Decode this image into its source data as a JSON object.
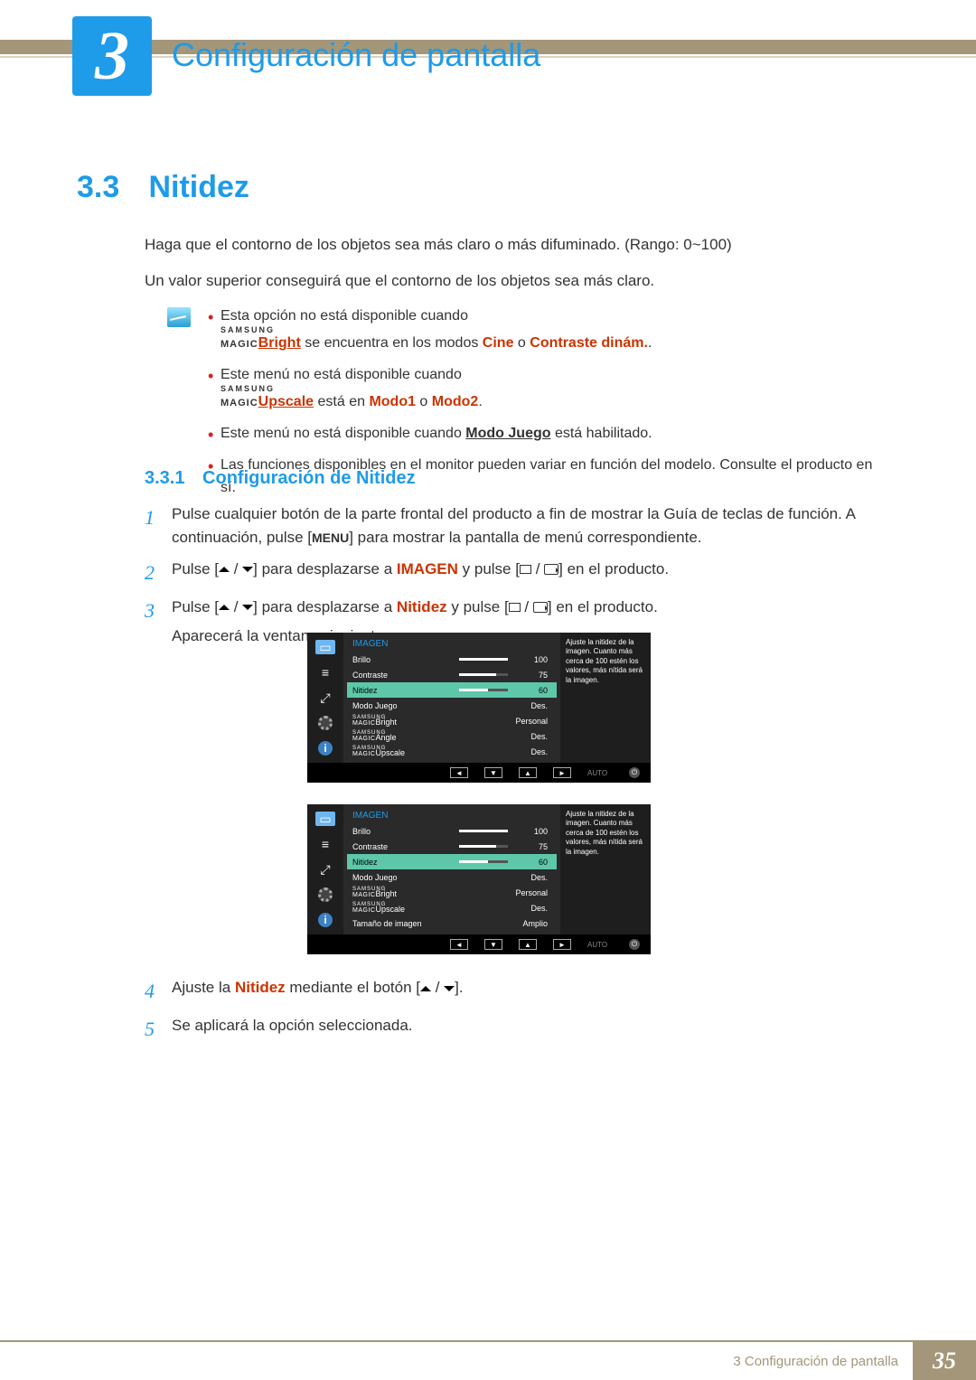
{
  "chapter": {
    "number": "3",
    "title": "Configuración de pantalla"
  },
  "section": {
    "number": "3.3",
    "title": "Nitidez"
  },
  "para1": "Haga que el contorno de los objetos sea más claro o más difuminado. (Rango: 0~100)",
  "para2": "Un valor superior conseguirá que el contorno de los objetos sea más claro.",
  "notes": {
    "n1a": "Esta opción no está disponible cuando ",
    "n1_brand_top": "SAMSUNG",
    "n1_brand_bot": "MAGIC",
    "n1_bright": "Bright",
    "n1b": " se encuentra en los modos ",
    "n1_cine": "Cine",
    "n1c": " o ",
    "n1_dyn": "Contraste dinám.",
    "n1d": ".",
    "n2a": "Este menú no está disponible cuando ",
    "n2_upscale": "Upscale",
    "n2b": " está en ",
    "n2_m1": "Modo1",
    "n2_o": " o ",
    "n2_m2": "Modo2",
    "n2c": ".",
    "n3a": "Este menú no está disponible cuando ",
    "n3_mj": "Modo Juego",
    "n3b": " está habilitado.",
    "n4": "Las funciones disponibles en el monitor pueden variar en función del modelo. Consulte el producto en sí."
  },
  "subsection": {
    "number": "3.3.1",
    "title": "Configuración de Nitidez"
  },
  "steps": {
    "s1a": "Pulse cualquier botón de la parte frontal del producto a fin de mostrar la Guía de teclas de función. A continuación, pulse [",
    "menu": "MENU",
    "s1b": "] para mostrar la pantalla de menú correspondiente.",
    "s2a": "Pulse [",
    "s2b": "] para desplazarse a ",
    "imagen": "IMAGEN",
    "s2c": " y pulse [",
    "s2d": "] en el producto.",
    "s3a": "Pulse [",
    "s3b": "] para desplazarse a ",
    "nitidez": "Nitidez",
    "s3c": " y pulse [",
    "s3d": "] en el producto.",
    "s3e": "Aparecerá la ventana siguiente.",
    "s4a": "Ajuste la ",
    "s4b": " mediante el botón [",
    "s4c": "].",
    "s5": "Se aplicará la opción seleccionada."
  },
  "osd": {
    "title": "IMAGEN",
    "desc": "Ajuste la nitidez de la imagen.\nCuanto más cerca de 100 estén los valores, más nítida será la imagen.",
    "auto": "AUTO",
    "magic_top": "SAMSUNG",
    "magic_bot": "MAGIC",
    "rows_a": [
      {
        "label": "Brillo",
        "val": "100",
        "fill": 100
      },
      {
        "label": "Contraste",
        "val": "75",
        "fill": 75
      },
      {
        "label": "Nitidez",
        "val": "60",
        "fill": 60,
        "sel": true
      },
      {
        "label": "Modo Juego",
        "val": "Des."
      },
      {
        "label": "Bright",
        "magic": true,
        "val": "Personal"
      },
      {
        "label": "Angle",
        "magic": true,
        "val": "Des."
      },
      {
        "label": "Upscale",
        "magic": true,
        "val": "Des."
      }
    ],
    "rows_b": [
      {
        "label": "Brillo",
        "val": "100",
        "fill": 100
      },
      {
        "label": "Contraste",
        "val": "75",
        "fill": 75
      },
      {
        "label": "Nitidez",
        "val": "60",
        "fill": 60,
        "sel": true
      },
      {
        "label": "Modo Juego",
        "val": "Des."
      },
      {
        "label": "Bright",
        "magic": true,
        "val": "Personal"
      },
      {
        "label": "Upscale",
        "magic": true,
        "val": "Des."
      },
      {
        "label": "Tamaño de imagen",
        "val": "Amplio"
      }
    ]
  },
  "footer": {
    "label": "3 Configuración de pantalla",
    "page": "35"
  }
}
